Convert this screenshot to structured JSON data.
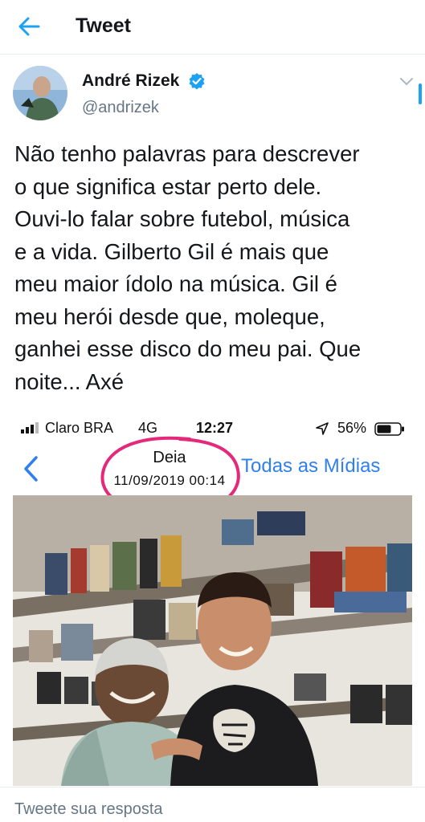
{
  "header": {
    "title": "Tweet",
    "back_icon": "arrow-left-icon"
  },
  "tweet": {
    "author_name": "André Rizek",
    "author_handle": "@andrizek",
    "verified": true,
    "text_lines": [
      "Não tenho palavras para descrever",
      "o que significa estar perto dele.",
      "Ouvi-lo falar sobre futebol, música",
      "e a vida. Gilberto Gil é mais que",
      "meu maior ídolo na música. Gil é",
      "meu herói desde que, moleque,",
      "ganhei esse disco do meu pai. Que",
      "noite... Axé"
    ]
  },
  "photo": {
    "status_bar": {
      "carrier": "Claro BRA",
      "network": "4G",
      "time": "12:27",
      "battery": "56%"
    },
    "nav": {
      "title": "Deia",
      "date": "11/09/2019 00:14",
      "right_link": "Todas as Mídias"
    }
  },
  "reply": {
    "placeholder": "Tweete sua resposta"
  },
  "colors": {
    "twitter_blue": "#1da1f2",
    "ios_blue": "#2f80ed",
    "highlight_pink": "#e4287a"
  }
}
